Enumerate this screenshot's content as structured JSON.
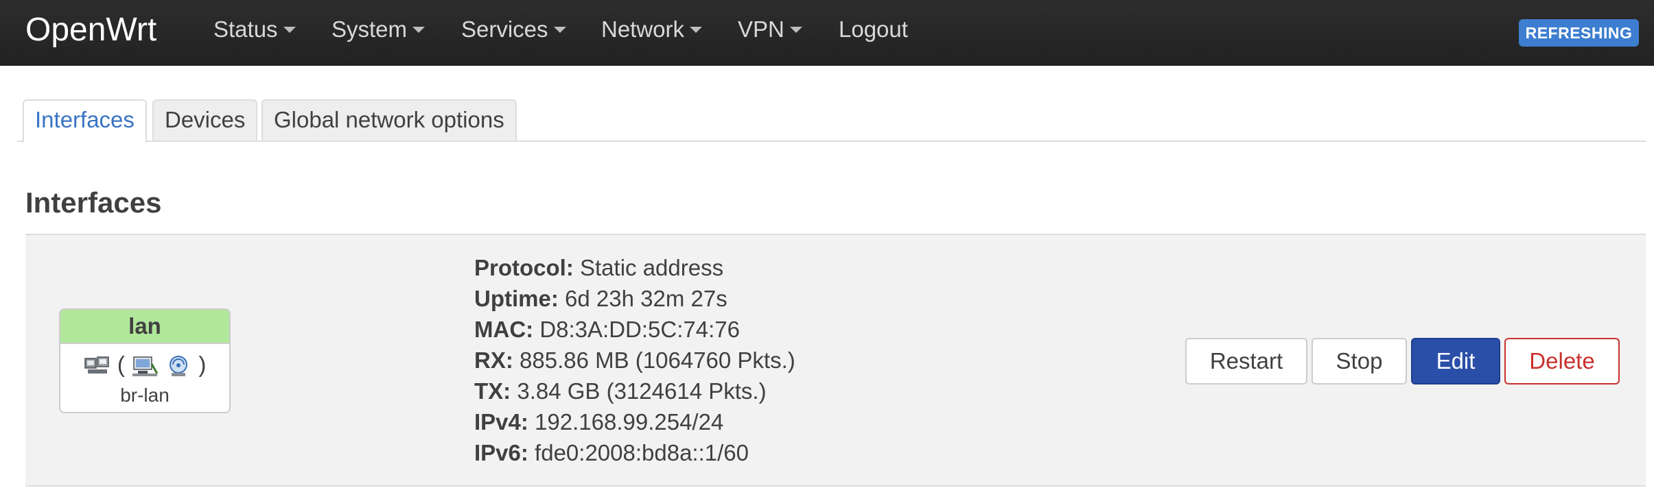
{
  "header": {
    "brand": "OpenWrt",
    "menu": [
      {
        "label": "Status",
        "dropdown": true
      },
      {
        "label": "System",
        "dropdown": true
      },
      {
        "label": "Services",
        "dropdown": true
      },
      {
        "label": "Network",
        "dropdown": true
      },
      {
        "label": "VPN",
        "dropdown": true
      },
      {
        "label": "Logout",
        "dropdown": false
      }
    ],
    "badge": "REFRESHING"
  },
  "tabs": [
    {
      "label": "Interfaces",
      "active": true
    },
    {
      "label": "Devices",
      "active": false
    },
    {
      "label": "Global network options",
      "active": false
    }
  ],
  "section_title": "Interfaces",
  "interface": {
    "name": "lan",
    "device": "br-lan",
    "icons": [
      "ethernet-ports-icon",
      "bridge-computer-icon",
      "wireless-icon"
    ],
    "details": {
      "protocol_label": "Protocol:",
      "protocol": "Static address",
      "uptime_label": "Uptime:",
      "uptime": "6d 23h 32m 27s",
      "mac_label": "MAC:",
      "mac": "D8:3A:DD:5C:74:76",
      "rx_label": "RX:",
      "rx": "885.86 MB (1064760 Pkts.)",
      "tx_label": "TX:",
      "tx": "3.84 GB (3124614 Pkts.)",
      "ipv4_label": "IPv4:",
      "ipv4": "192.168.99.254/24",
      "ipv6_label": "IPv6:",
      "ipv6": "fde0:2008:bd8a::1/60"
    },
    "buttons": {
      "restart": "Restart",
      "stop": "Stop",
      "edit": "Edit",
      "delete": "Delete"
    }
  },
  "colors": {
    "header_bg": "#222222",
    "badge_bg": "#3d7ed0",
    "active_tab_text": "#3974c4",
    "interface_head_bg": "#b0e79a",
    "edit_button_bg": "#2a4fa8",
    "delete_button_border": "#c9302c"
  }
}
